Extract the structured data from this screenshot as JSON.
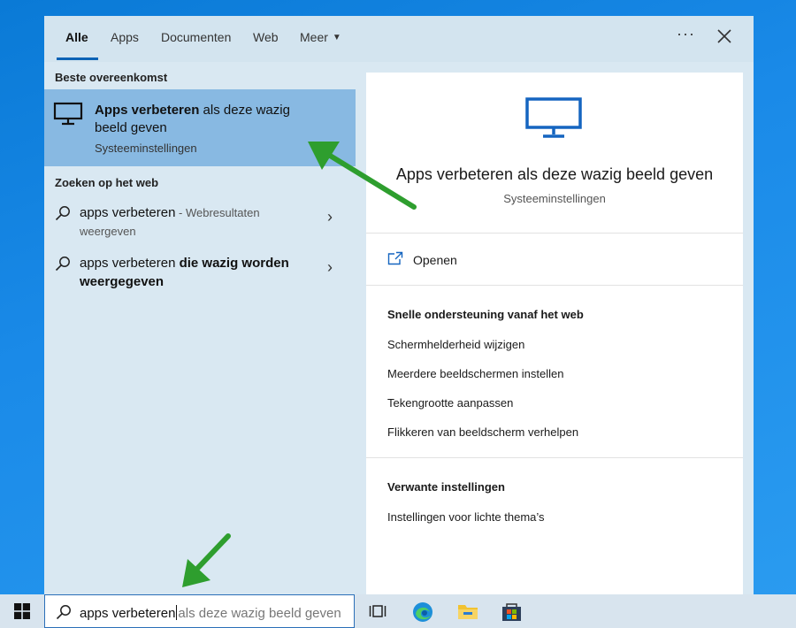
{
  "tabs": [
    {
      "label": "Alle",
      "active": true
    },
    {
      "label": "Apps",
      "active": false
    },
    {
      "label": "Documenten",
      "active": false
    },
    {
      "label": "Web",
      "active": false
    },
    {
      "label": "Meer",
      "active": false
    }
  ],
  "more_label": "···",
  "left": {
    "best_match_header": "Beste overeenkomst",
    "best_match": {
      "title_bold": "Apps verbeteren",
      "title_rest": " als deze wazig beeld geven",
      "subtitle": "Systeeminstellingen"
    },
    "web_header": "Zoeken op het web",
    "web_results": [
      {
        "bold": "",
        "text": "apps verbeteren",
        "suffix": " - Webresultaten weergeven"
      },
      {
        "bold": " die wazig worden weergegeven",
        "text": "apps verbeteren",
        "suffix": ""
      }
    ]
  },
  "right": {
    "title": "Apps verbeteren als deze wazig beeld geven",
    "subtitle": "Systeeminstellingen",
    "open_label": "Openen",
    "web_help_header": "Snelle ondersteuning vanaf het web",
    "web_help_links": [
      "Schermhelderheid wijzigen",
      "Meerdere beeldschermen instellen",
      "Tekengrootte aanpassen",
      "Flikkeren van beeldscherm verhelpen"
    ],
    "related_header": "Verwante instellingen",
    "related_links": [
      "Instellingen voor lichte thema’s"
    ]
  },
  "taskbar": {
    "search_query": "apps verbeteren",
    "search_completion": "als deze wazig beeld geven"
  },
  "colors": {
    "accent": "#0b62b5",
    "selected_row": "#88b9e2",
    "arrow_green": "#2e9e2e",
    "monitor_blue": "#1565c0"
  }
}
